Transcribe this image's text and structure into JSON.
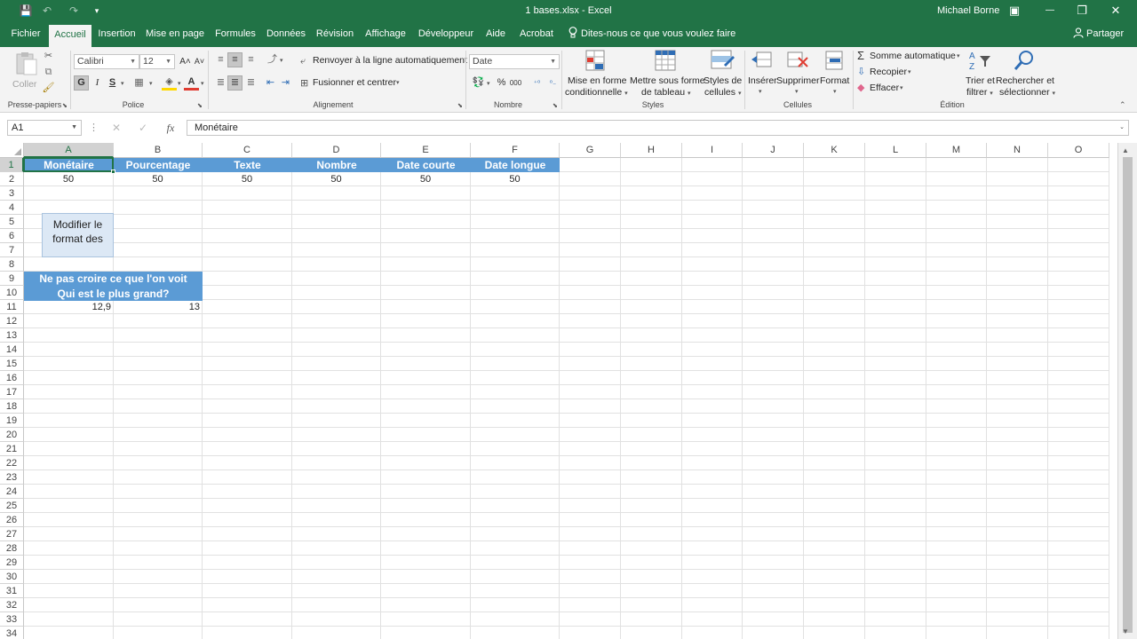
{
  "titlebar": {
    "title": "1 bases.xlsx  -  Excel",
    "user": "Michael Borne",
    "save_icon": "💾",
    "undo_icon": "↶",
    "redo_icon": "↷",
    "customize_icon": "▾",
    "ribbon_options_icon": "▣",
    "minimize": "—",
    "restore": "❐",
    "close": "✕"
  },
  "tabs": {
    "file": "Fichier",
    "home": "Accueil",
    "insert": "Insertion",
    "layout": "Mise en page",
    "formulas": "Formules",
    "data": "Données",
    "review": "Révision",
    "view": "Affichage",
    "developer": "Développeur",
    "help": "Aide",
    "acrobat": "Acrobat",
    "tellme": "Dites-nous ce que vous voulez faire",
    "share": "Partager"
  },
  "ribbon": {
    "clipboard": {
      "paste": "Coller",
      "label": "Presse-papiers"
    },
    "font": {
      "name": "Calibri",
      "size": "12",
      "bold": "G",
      "italic": "I",
      "underline": "S",
      "grow": "A˄",
      "shrink": "A˅",
      "label": "Police"
    },
    "alignment": {
      "wrap": "Renvoyer à la ligne automatiquement",
      "merge": "Fusionner et centrer",
      "label": "Alignement"
    },
    "number": {
      "format": "Date",
      "percent": "%",
      "thousands": "000",
      "label": "Nombre"
    },
    "styles": {
      "conditional_line1": "Mise en forme",
      "conditional_line2": "conditionnelle",
      "table_line1": "Mettre sous forme",
      "table_line2": "de tableau",
      "cell_line1": "Styles de",
      "cell_line2": "cellules",
      "label": "Styles"
    },
    "cells": {
      "insert": "Insérer",
      "delete": "Supprimer",
      "format": "Format",
      "label": "Cellules"
    },
    "editing": {
      "autosum": "Somme automatique",
      "fill": "Recopier",
      "clear": "Effacer",
      "sort_line1": "Trier et",
      "sort_line2": "filtrer",
      "find_line1": "Rechercher et",
      "find_line2": "sélectionner",
      "label": "Édition"
    }
  },
  "formula_bar": {
    "name_box": "A1",
    "cancel": "✕",
    "enter": "✓",
    "fx": "fx",
    "content": "Monétaire"
  },
  "sheet": {
    "columns": [
      "A",
      "B",
      "C",
      "D",
      "E",
      "F",
      "G",
      "H",
      "I",
      "J",
      "K",
      "L",
      "M",
      "N",
      "O"
    ],
    "rows": [
      "1",
      "2",
      "3",
      "4",
      "5",
      "6",
      "7",
      "8",
      "9",
      "10",
      "11",
      "12",
      "13",
      "14",
      "15",
      "16",
      "17",
      "18",
      "19",
      "20",
      "21",
      "22",
      "23",
      "24",
      "25",
      "26",
      "27",
      "28",
      "29",
      "30",
      "31",
      "32",
      "33",
      "34"
    ],
    "row1": [
      "Monétaire",
      "Pourcentage",
      "Texte",
      "Nombre",
      "Date courte",
      "Date longue"
    ],
    "row2": [
      "50",
      "50",
      "50",
      "50",
      "50",
      "50"
    ],
    "note_line1": "Modifier le",
    "note_line2": "format des",
    "banner_line1": "Ne pas croire ce que l'on voit",
    "banner_line2": "Qui est le plus grand?",
    "row11": [
      "12,9",
      "13"
    ]
  },
  "colors": {
    "excel_green": "#217346",
    "header_blue": "#5b9bd5",
    "note_fill": "#dce8f5"
  }
}
